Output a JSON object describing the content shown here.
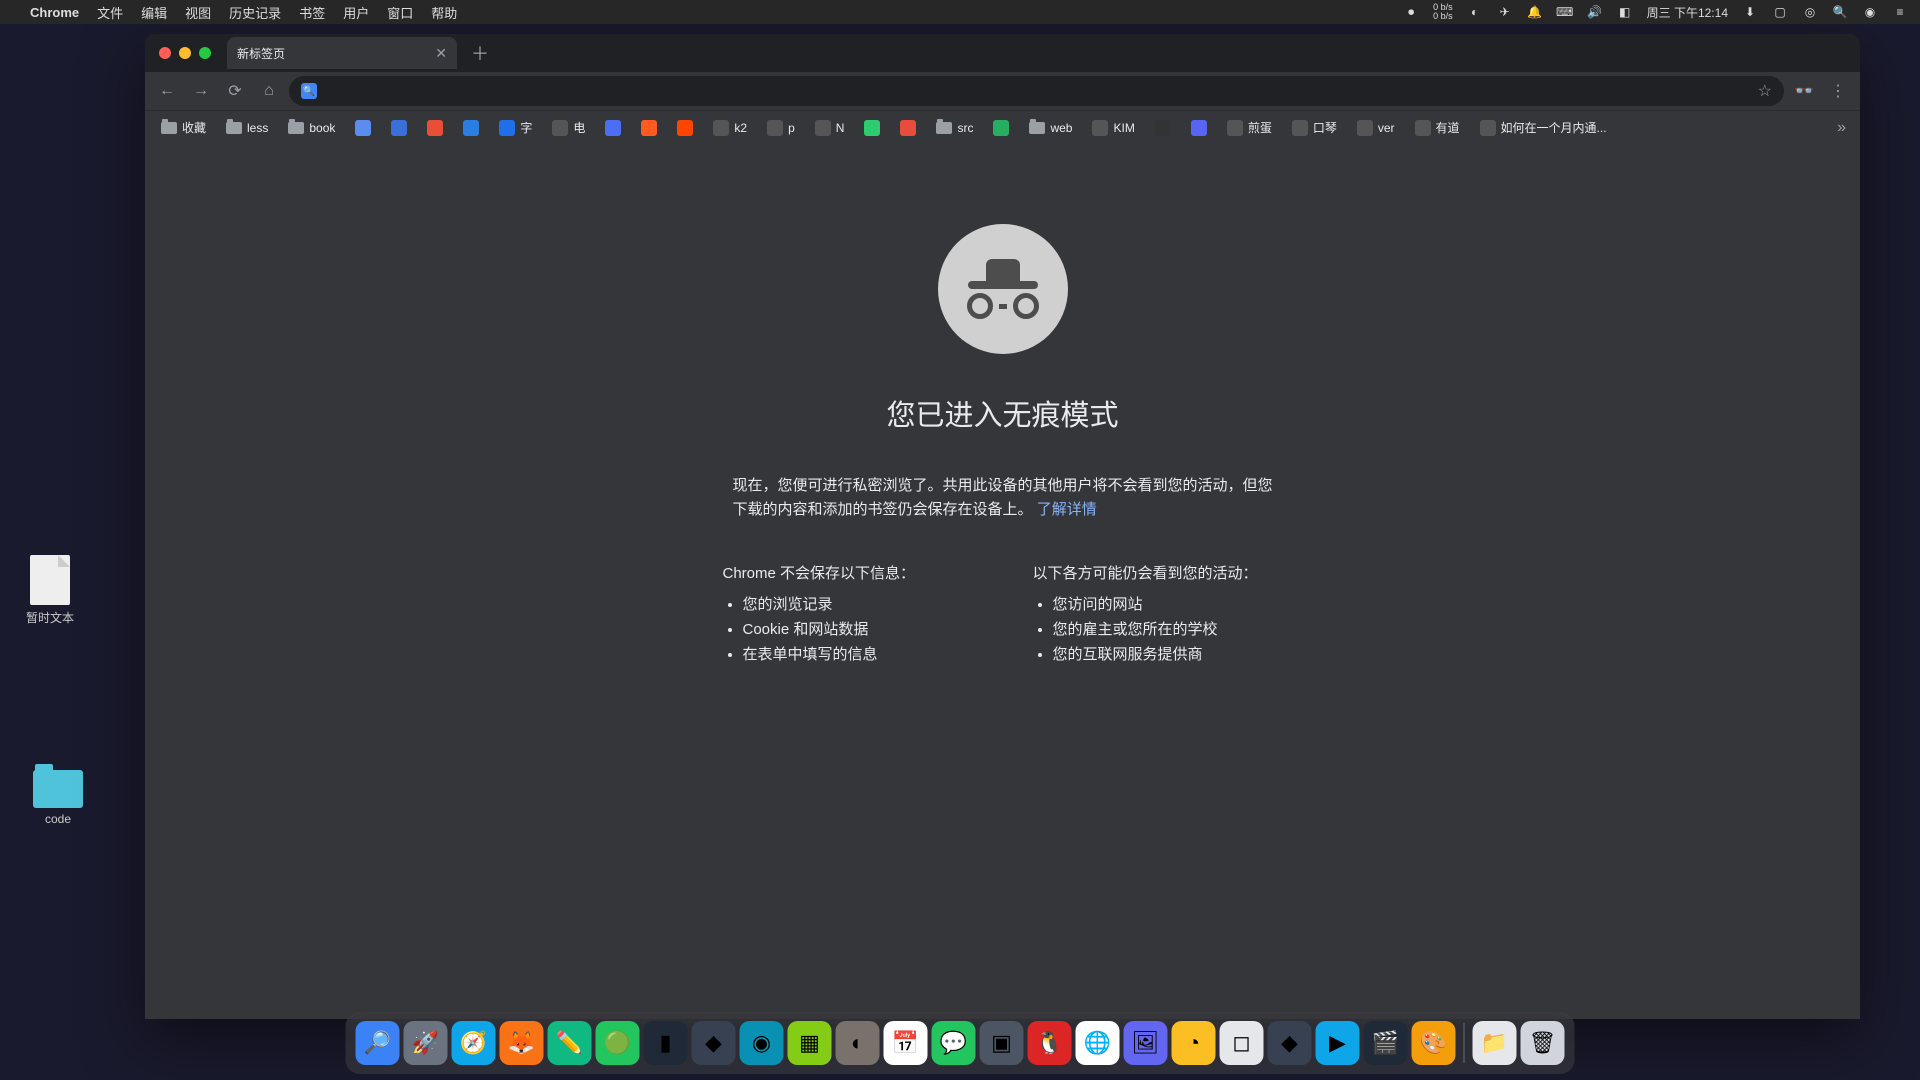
{
  "menubar": {
    "app": "Chrome",
    "items": [
      "文件",
      "编辑",
      "视图",
      "历史记录",
      "书签",
      "用户",
      "窗口",
      "帮助"
    ],
    "net_up": "0 b/s",
    "net_down": "0 b/s",
    "clock": "周三 下午12:14"
  },
  "desktop": {
    "file1": "暂时文本",
    "folder1": "code"
  },
  "tab": {
    "title": "新标签页"
  },
  "omnibox": {
    "value": ""
  },
  "bookmarks": [
    {
      "label": "收藏",
      "type": "folder"
    },
    {
      "label": "less",
      "type": "folder"
    },
    {
      "label": "book",
      "type": "folder"
    },
    {
      "label": "",
      "type": "icon",
      "color": "#5b8def"
    },
    {
      "label": "",
      "type": "icon",
      "color": "#3b6fd8"
    },
    {
      "label": "",
      "type": "icon",
      "color": "#e94f37"
    },
    {
      "label": "",
      "type": "icon",
      "color": "#2a7de1"
    },
    {
      "label": "字",
      "type": "icon",
      "color": "#1f6feb"
    },
    {
      "label": "电",
      "type": "text"
    },
    {
      "label": "",
      "type": "icon",
      "color": "#4c6ef5"
    },
    {
      "label": "",
      "type": "icon",
      "color": "#ff5a1f"
    },
    {
      "label": "",
      "type": "icon",
      "color": "#ff4500"
    },
    {
      "label": "k2",
      "type": "text"
    },
    {
      "label": "p",
      "type": "text"
    },
    {
      "label": "N",
      "type": "text"
    },
    {
      "label": "",
      "type": "icon",
      "color": "#2ecc71"
    },
    {
      "label": "",
      "type": "icon",
      "color": "#e74c3c"
    },
    {
      "label": "src",
      "type": "folder"
    },
    {
      "label": "",
      "type": "icon",
      "color": "#27ae60"
    },
    {
      "label": "web",
      "type": "folder"
    },
    {
      "label": "KIM",
      "type": "text"
    },
    {
      "label": "",
      "type": "icon",
      "color": "#333"
    },
    {
      "label": "",
      "type": "icon",
      "color": "#5865f2"
    },
    {
      "label": "煎蛋",
      "type": "text"
    },
    {
      "label": "口琴",
      "type": "text"
    },
    {
      "label": "ver",
      "type": "text"
    },
    {
      "label": "有道",
      "type": "text"
    },
    {
      "label": "如何在一个月内通...",
      "type": "text"
    }
  ],
  "page": {
    "heading": "您已进入无痕模式",
    "desc1": "现在，您便可进行私密浏览了。共用此设备的其他用户将不会看到您的活动，但您下载的内容和添加的书签仍会保存在设备上。",
    "learn_more": "了解详情",
    "col1_prefix": "Chrome ",
    "col1_em": "不会保存",
    "col1_suffix": "以下信息：",
    "col1_items": [
      "您的浏览记录",
      "Cookie 和网站数据",
      "在表单中填写的信息"
    ],
    "col2_prefix": "以下各方",
    "col2_em": "可能仍会看到",
    "col2_suffix": "您的活动：",
    "col2_items": [
      "您访问的网站",
      "您的雇主或您所在的学校",
      "您的互联网服务提供商"
    ]
  }
}
